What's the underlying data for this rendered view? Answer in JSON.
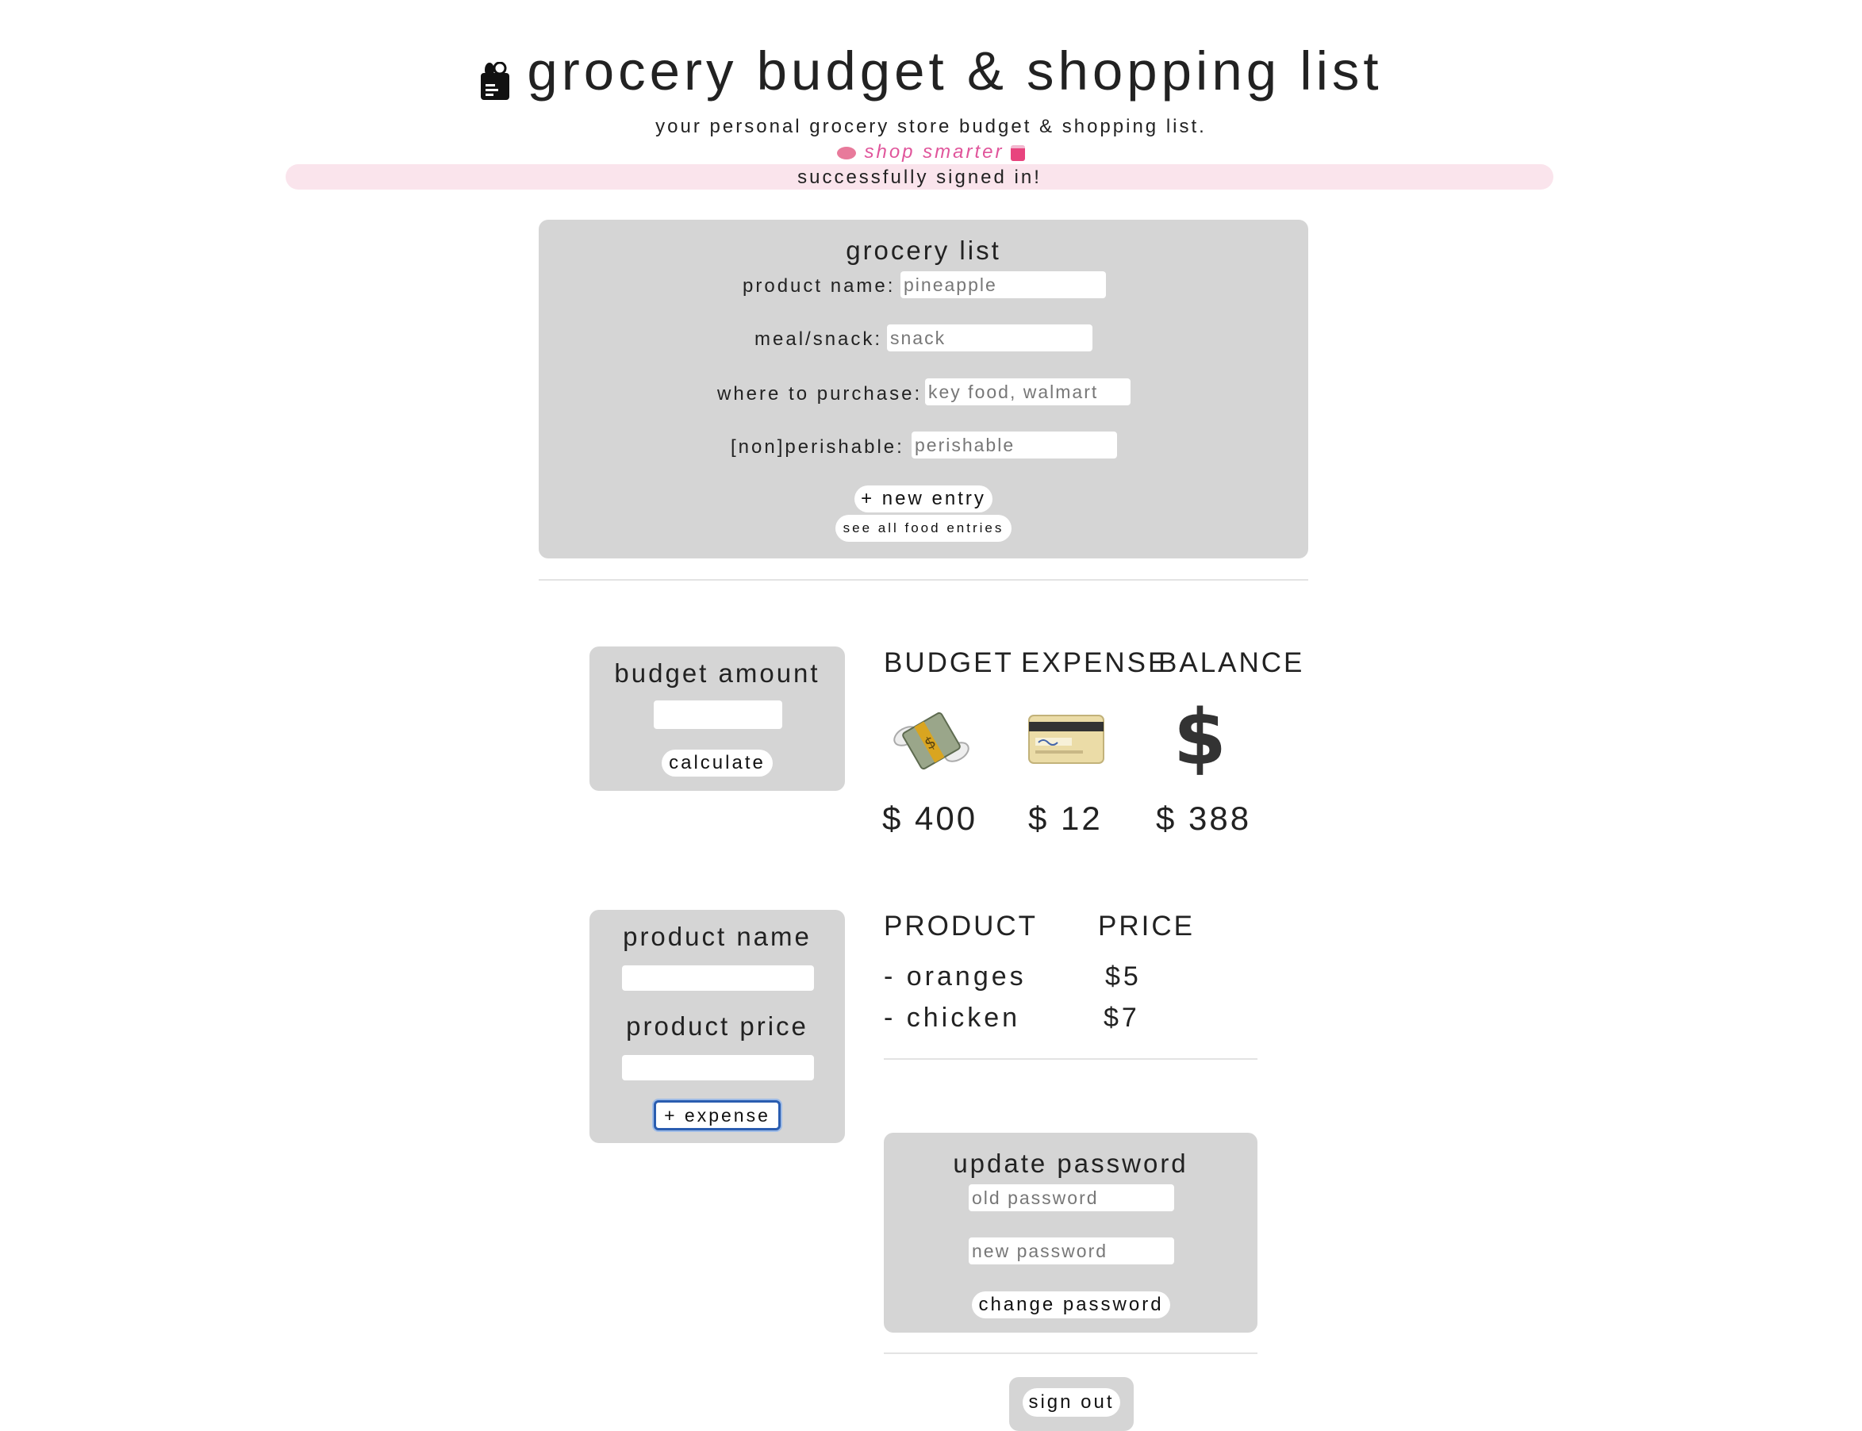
{
  "header": {
    "title": "grocery budget & shopping list",
    "subtitle": "your personal grocery store budget & shopping list.",
    "tagline": "shop smarter",
    "status": "successfully signed in!"
  },
  "grocery_list": {
    "heading": "grocery list",
    "fields": [
      {
        "label": "product name:",
        "placeholder": "pineapple"
      },
      {
        "label": "meal/snack:",
        "placeholder": "snack"
      },
      {
        "label": "where to purchase:",
        "placeholder": "key food, walmart"
      },
      {
        "label": "[non]perishable:",
        "placeholder": "perishable"
      }
    ],
    "new_entry_label": "+ new entry",
    "see_all_label": "see all food entries"
  },
  "budget_form": {
    "heading": "budget amount",
    "calculate_label": "calculate"
  },
  "summary": {
    "columns": [
      {
        "label": "BUDGET",
        "icon": "money-with-wings-icon",
        "amount": "$ 400"
      },
      {
        "label": "EXPENSE",
        "icon": "credit-card-icon",
        "amount": "$ 12"
      },
      {
        "label": "BALANCE",
        "icon": "dollar-sign-icon",
        "amount": "$ 388"
      }
    ]
  },
  "expense_form": {
    "name_label": "product name",
    "price_label": "product price",
    "add_label": "+ expense"
  },
  "expenses": {
    "headers": [
      "PRODUCT",
      "PRICE"
    ],
    "rows": [
      {
        "product": "- oranges",
        "price": "$5"
      },
      {
        "product": "- chicken",
        "price": "$7"
      }
    ]
  },
  "password": {
    "heading": "update password",
    "old_placeholder": "old password",
    "new_placeholder": "new password",
    "change_label": "change password"
  },
  "sign_out_label": "sign out",
  "colors": {
    "panel": "#d5d5d5",
    "status_bar": "#fae4ec",
    "tagline": "#e0559b",
    "focus_ring": "#2a5db0"
  }
}
